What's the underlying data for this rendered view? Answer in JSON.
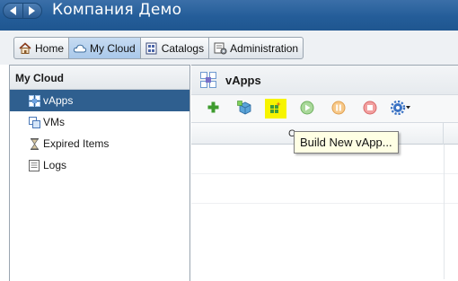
{
  "header": {
    "org_title": "Компания Демо",
    "back_icon": "back-arrow-icon",
    "forward_icon": "forward-arrow-icon"
  },
  "tabs": [
    {
      "label": "Home",
      "icon": "home-icon",
      "active": false
    },
    {
      "label": "My Cloud",
      "icon": "cloud-icon",
      "active": true
    },
    {
      "label": "Catalogs",
      "icon": "catalog-icon",
      "active": false
    },
    {
      "label": "Administration",
      "icon": "administration-icon",
      "active": false
    }
  ],
  "sidebar": {
    "title": "My Cloud",
    "items": [
      {
        "label": "vApps",
        "icon": "vapps-icon",
        "selected": true
      },
      {
        "label": "VMs",
        "icon": "vms-icon",
        "selected": false
      },
      {
        "label": "Expired Items",
        "icon": "hourglass-icon",
        "selected": false
      },
      {
        "label": "Logs",
        "icon": "logs-icon",
        "selected": false
      }
    ]
  },
  "main": {
    "title": "vApps",
    "title_icon": "vapps-icon",
    "toolbar": [
      {
        "name": "add",
        "icon": "plus-icon"
      },
      {
        "name": "add-from-catalog",
        "icon": "add-from-catalog-icon"
      },
      {
        "name": "build-new-vapp",
        "icon": "build-vapp-icon",
        "highlighted": true
      },
      {
        "name": "start",
        "icon": "play-icon"
      },
      {
        "name": "suspend",
        "icon": "pause-icon"
      },
      {
        "name": "stop",
        "icon": "stop-icon"
      },
      {
        "name": "actions",
        "icon": "gear-dropdown-icon"
      }
    ],
    "tooltip": "Build New vApp...",
    "grid_header_fragment": "C"
  },
  "colors": {
    "banner": "#245d99",
    "selected_item": "#2f5f8f",
    "active_tab": "#b6d0ee",
    "highlight": "#f7f400",
    "tooltip_bg": "#ffffe4"
  }
}
